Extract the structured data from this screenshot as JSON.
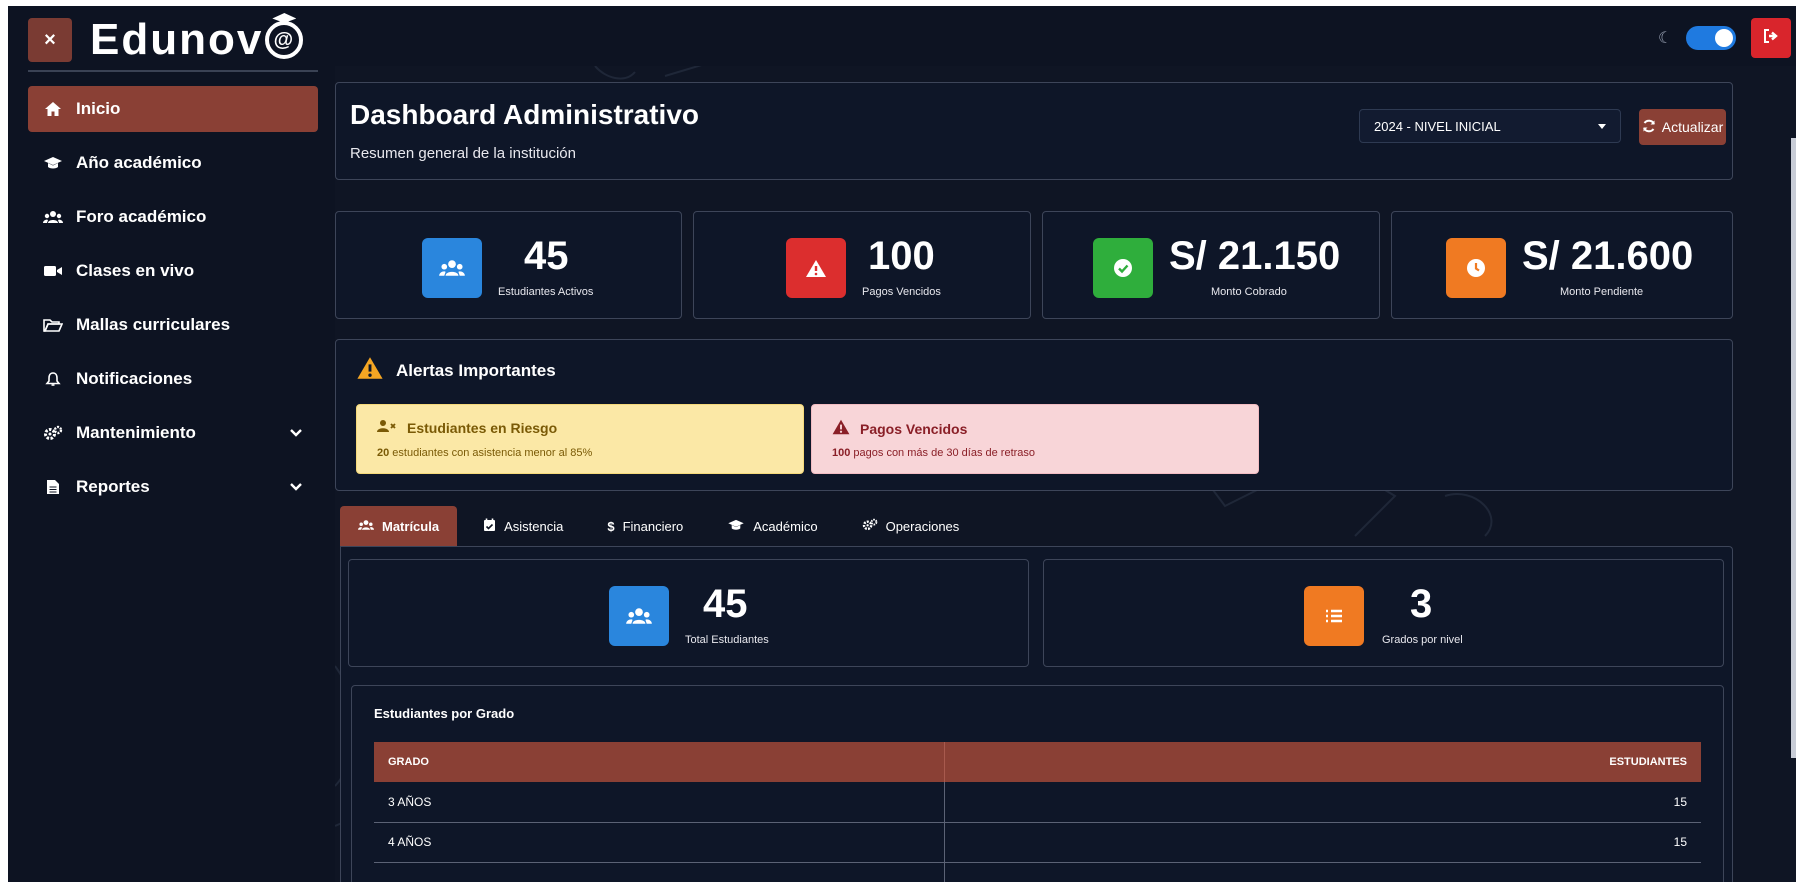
{
  "brand": {
    "name": "Edunov",
    "mark": "@",
    "close_label": "×"
  },
  "sidebar": {
    "items": [
      {
        "label": "Inicio",
        "icon": "home-icon",
        "active": true
      },
      {
        "label": "Año académico",
        "icon": "graduation-cap-icon"
      },
      {
        "label": "Foro académico",
        "icon": "users-icon"
      },
      {
        "label": "Clases en vivo",
        "icon": "video-icon"
      },
      {
        "label": "Mallas curriculares",
        "icon": "folder-open-icon"
      },
      {
        "label": "Notificaciones",
        "icon": "bell-icon"
      },
      {
        "label": "Mantenimiento",
        "icon": "cogs-icon",
        "expandable": true
      },
      {
        "label": "Reportes",
        "icon": "file-icon",
        "expandable": true
      }
    ]
  },
  "header": {
    "title": "Dashboard Administrativo",
    "subtitle": "Resumen general de la institución",
    "year_select": "2024 - NIVEL INICIAL",
    "refresh_label": "Actualizar"
  },
  "stats": [
    {
      "value": "45",
      "label": "Estudiantes Activos",
      "icon": "users-icon",
      "color": "#2a86dd"
    },
    {
      "value": "100",
      "label": "Pagos Vencidos",
      "icon": "warning-icon",
      "color": "#dc2e2e"
    },
    {
      "value": "S/ 21.150",
      "label": "Monto Cobrado",
      "icon": "check-circle-icon",
      "color": "#2fae3c"
    },
    {
      "value": "S/ 21.600",
      "label": "Monto Pendiente",
      "icon": "clock-icon",
      "color": "#f07a22"
    }
  ],
  "alerts": {
    "title": "Alertas Importantes",
    "items": [
      {
        "title": "Estudiantes en Riesgo",
        "count": "20",
        "text": " estudiantes con asistencia menor al 85%"
      },
      {
        "title": "Pagos Vencidos",
        "count": "100",
        "text": " pagos con más de 30 días de retraso"
      }
    ]
  },
  "tabs": [
    {
      "label": "Matrícula",
      "icon": "users-icon",
      "active": true
    },
    {
      "label": "Asistencia",
      "icon": "calendar-check-icon"
    },
    {
      "label": "Financiero",
      "icon": "dollar-icon"
    },
    {
      "label": "Académico",
      "icon": "graduation-cap-icon"
    },
    {
      "label": "Operaciones",
      "icon": "cogs-icon"
    }
  ],
  "enrollment": {
    "summary": [
      {
        "value": "45",
        "label": "Total Estudiantes",
        "icon": "users-icon",
        "color": "#2a86dd"
      },
      {
        "value": "3",
        "label": "Grados por nivel",
        "icon": "list-icon",
        "color": "#f07a22"
      }
    ],
    "grade_table": {
      "title": "Estudiantes por Grado",
      "columns": [
        "GRADO",
        "ESTUDIANTES"
      ],
      "rows": [
        {
          "grade": "3 AÑOS",
          "students": "15"
        },
        {
          "grade": "4 AÑOS",
          "students": "15"
        },
        {
          "grade": "",
          "students": ""
        }
      ]
    }
  },
  "colors": {
    "accent": "#8a4035",
    "background": "#0d1322",
    "card_border": "#3d4559",
    "logout": "#d9252c",
    "toggle": "#1f7ae0"
  }
}
